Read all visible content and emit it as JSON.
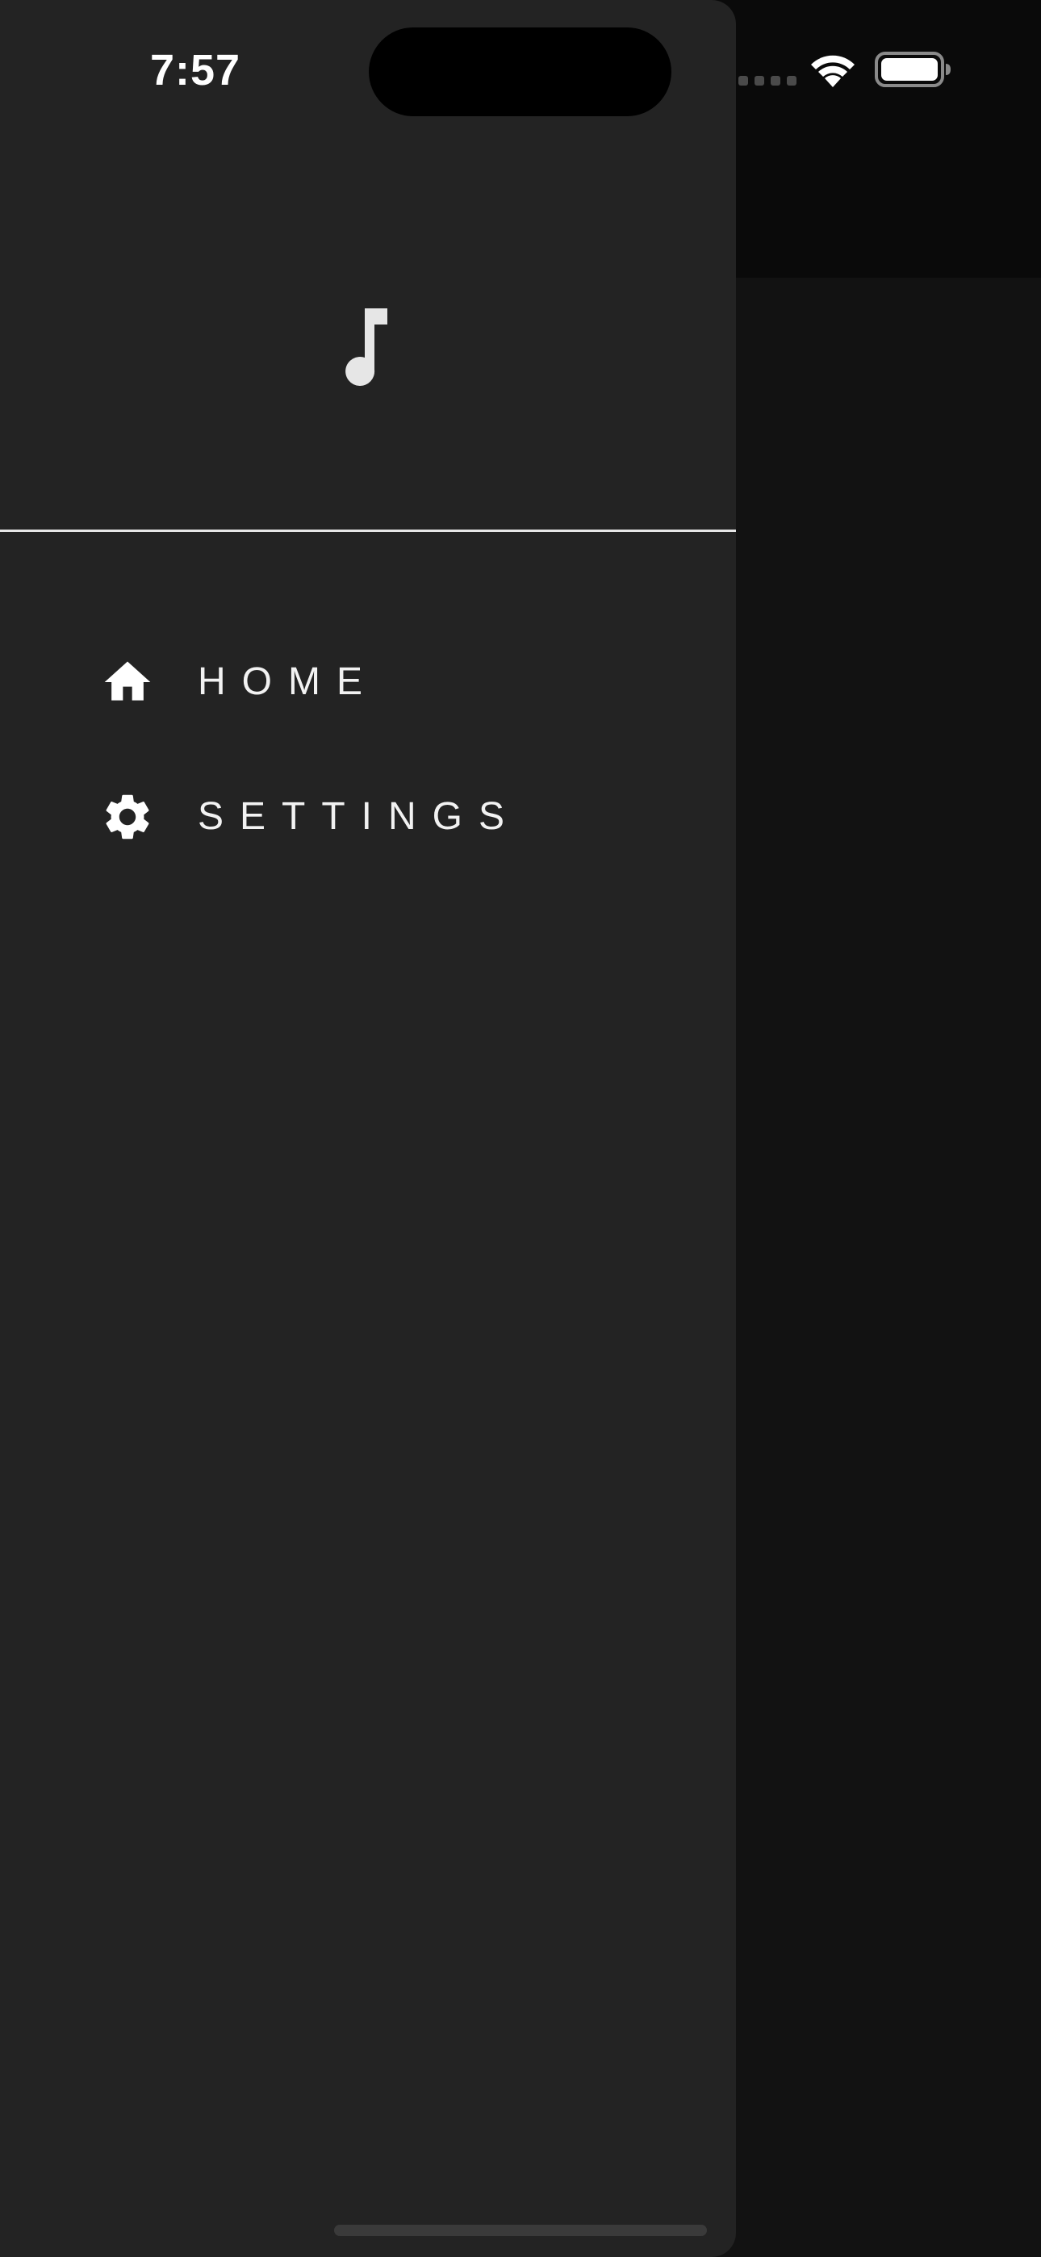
{
  "status_bar": {
    "time": "7:57"
  },
  "drawer": {
    "header_icon": "music-note-icon",
    "items": [
      {
        "label": "HOME",
        "icon": "home-icon"
      },
      {
        "label": "SETTINGS",
        "icon": "gear-icon"
      }
    ]
  },
  "colors": {
    "drawer_background": "#232323",
    "scrim_background": "#121212",
    "text": "#f2f2f2",
    "divider": "#e6e6e6"
  }
}
